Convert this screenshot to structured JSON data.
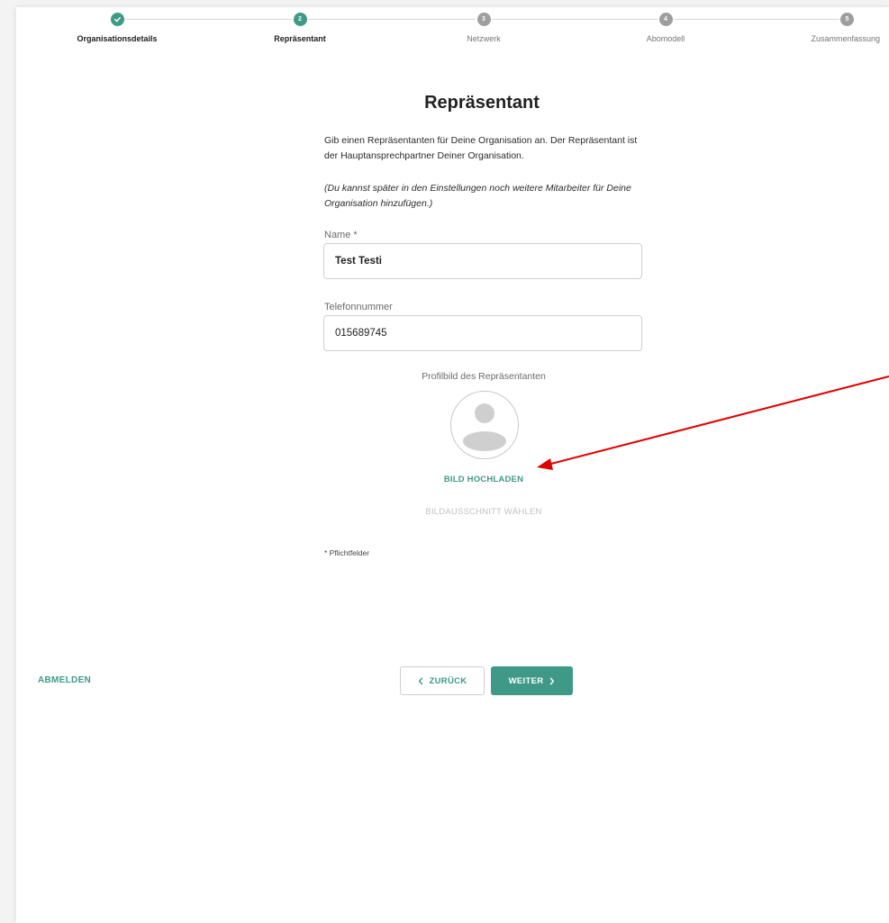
{
  "stepper": {
    "steps": [
      {
        "number": "",
        "label": "Organisationsdetails",
        "state": "done"
      },
      {
        "number": "2",
        "label": "Repräsentant",
        "state": "active"
      },
      {
        "number": "3",
        "label": "Netzwerk",
        "state": "pending"
      },
      {
        "number": "4",
        "label": "Abomodell",
        "state": "pending"
      },
      {
        "number": "5",
        "label": "Zusammenfassung",
        "state": "pending"
      }
    ]
  },
  "page": {
    "title": "Repräsentant",
    "intro": "Gib einen Repräsentanten für Deine Organisation an. Der Repräsentant ist der Hauptansprechpartner Deiner Organisation.",
    "intro_italic": "(Du kannst später in den Einstellungen noch weitere Mitarbeiter für Deine Organisation hinzufügen.)"
  },
  "form": {
    "name_label": "Name *",
    "name_value": "Test Testi",
    "phone_label": "Telefonnummer",
    "phone_value": "015689745",
    "profile_label": "Profilbild des Repräsentanten",
    "upload_label": "BILD HOCHLADEN",
    "crop_label": "BILDAUSSCHNITT WÄHLEN",
    "required_note": "* Pflichtfelder"
  },
  "footer": {
    "logout_label": "ABMELDEN",
    "back_label": "ZURÜCK",
    "next_label": "WEITER"
  },
  "colors": {
    "accent": "#3e9a86",
    "pending_step": "#9e9e9e",
    "annotation_arrow": "#e00000"
  },
  "icons": {
    "done_step": "check-icon",
    "avatar": "person-placeholder-icon",
    "back": "chevron-left-icon",
    "next": "chevron-right-icon"
  }
}
